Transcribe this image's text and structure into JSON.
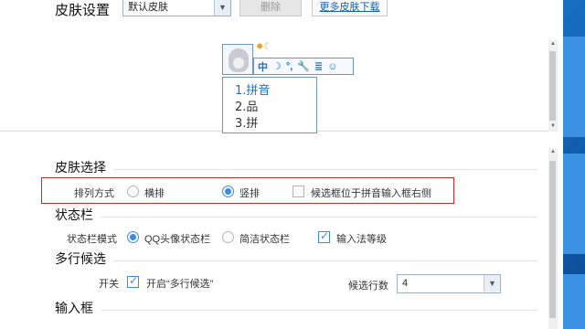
{
  "top": {
    "title": "皮肤设置",
    "skin_select_value": "默认皮肤",
    "delete_label": "删除",
    "more_skins_label": "更多皮肤下载"
  },
  "preview": {
    "toolbar_items": [
      "中",
      "☽",
      "°,",
      "🔧",
      "≣",
      "☺"
    ],
    "candidates": [
      "1.拼音",
      "2.品",
      "3.拼"
    ]
  },
  "settings": {
    "skin_section_title": "皮肤选择",
    "layout_label": "排列方式",
    "layout_horizontal": "横排",
    "layout_vertical": "竖排",
    "layout_selected": "竖排",
    "candidate_right_label": "候选框位于拼音输入框右侧",
    "candidate_right_checked": false,
    "status_section_title": "状态栏",
    "status_mode_label": "状态栏模式",
    "status_qq": "QQ头像状态栏",
    "status_simple": "简洁状态栏",
    "status_selected": "QQ头像状态栏",
    "show_level_label": "输入法等级",
    "show_level_checked": true,
    "multirow_section_title": "多行候选",
    "switch_label": "开关",
    "multirow_enable_label": "开启“多行候选”",
    "multirow_enable_checked": true,
    "rows_label": "候选行数",
    "rows_value": "4",
    "input_section_title": "输入框"
  }
}
